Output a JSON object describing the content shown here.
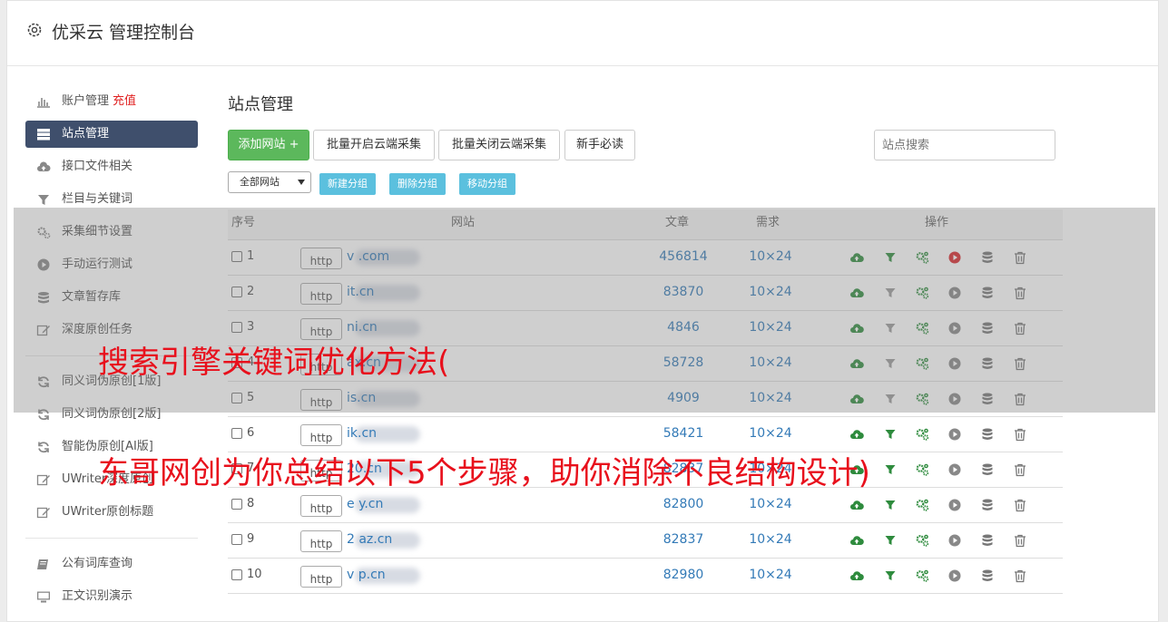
{
  "header": {
    "title": "优采云 管理控制台"
  },
  "sidebar": {
    "items": [
      {
        "icon": "bar-chart-icon",
        "label": "账户管理",
        "extra": "充值"
      },
      {
        "icon": "server-icon",
        "label": "站点管理",
        "active": true
      },
      {
        "icon": "cloud-upload-icon",
        "label": "接口文件相关"
      },
      {
        "icon": "filter-icon",
        "label": "栏目与关键词"
      },
      {
        "icon": "gears-icon",
        "label": "采集细节设置"
      },
      {
        "icon": "play-icon",
        "label": "手动运行测试"
      },
      {
        "icon": "database-icon",
        "label": "文章暂存库"
      },
      {
        "icon": "edit-icon",
        "label": "深度原创任务"
      }
    ],
    "items2": [
      {
        "icon": "refresh-icon",
        "label": "同义词伪原创[1版]"
      },
      {
        "icon": "refresh-icon",
        "label": "同义词伪原创[2版]"
      },
      {
        "icon": "refresh-icon",
        "label": "智能伪原创[AI版]"
      },
      {
        "icon": "edit-icon",
        "label": "UWriter深度原创"
      },
      {
        "icon": "edit-icon",
        "label": "UWriter原创标题"
      }
    ],
    "items3": [
      {
        "icon": "book-icon",
        "label": "公有词库查询"
      },
      {
        "icon": "monitor-icon",
        "label": "正文识别演示"
      }
    ]
  },
  "main": {
    "title": "站点管理",
    "buttons": {
      "add": "添加网站 +",
      "batch_open": "批量开启云端采集",
      "batch_close": "批量关闭云端采集",
      "guide": "新手必读"
    },
    "search_placeholder": "站点搜索",
    "group_select": "全部网站",
    "group_buttons": {
      "new": "新建分组",
      "delete": "删除分组",
      "move": "移动分组"
    },
    "table": {
      "headers": {
        "no": "序号",
        "site": "网站",
        "articles": "文章",
        "demand": "需求",
        "ops": "操作"
      },
      "rows": [
        {
          "no": "1",
          "scheme": "http",
          "domain": "v           .com",
          "articles": "456814",
          "demand": "10×24",
          "active": true
        },
        {
          "no": "2",
          "scheme": "http",
          "domain": "        it.cn",
          "articles": "83870",
          "demand": "10×24",
          "active": false
        },
        {
          "no": "3",
          "scheme": "http",
          "domain": "        ni.cn",
          "articles": "4846",
          "demand": "10×24",
          "active": false
        },
        {
          "no": "4",
          "scheme": "http",
          "domain": "        ax.cn",
          "articles": "58728",
          "demand": "10×24",
          "active": false
        },
        {
          "no": "5",
          "scheme": "http",
          "domain": "        is.cn",
          "articles": "4909",
          "demand": "10×24",
          "active": false
        },
        {
          "no": "6",
          "scheme": "http",
          "domain": "        ik.cn",
          "articles": "58421",
          "demand": "10×24",
          "active": true
        },
        {
          "no": "7",
          "scheme": "http",
          "domain": "        20.cn",
          "articles": "82837",
          "demand": "10×24",
          "active": true
        },
        {
          "no": "8",
          "scheme": "http",
          "domain": "e        y.cn",
          "articles": "82800",
          "demand": "10×24",
          "active": true
        },
        {
          "no": "9",
          "scheme": "http",
          "domain": "2        az.cn",
          "articles": "82837",
          "demand": "10×24",
          "active": true
        },
        {
          "no": "10",
          "scheme": "http",
          "domain": "v        p.cn",
          "articles": "82980",
          "demand": "10×24",
          "active": true
        }
      ]
    }
  },
  "overlay": {
    "line1": "搜索引擎关键词优化方法(",
    "line2": "东哥网创为你总结以下5个步骤，助你消除不良结构设计)"
  },
  "colors": {
    "accent_active": "#3f4f6c",
    "green": "#5cb85c",
    "info": "#5bc0de",
    "link": "#337ab7",
    "overlay_text": "#e8101c"
  }
}
